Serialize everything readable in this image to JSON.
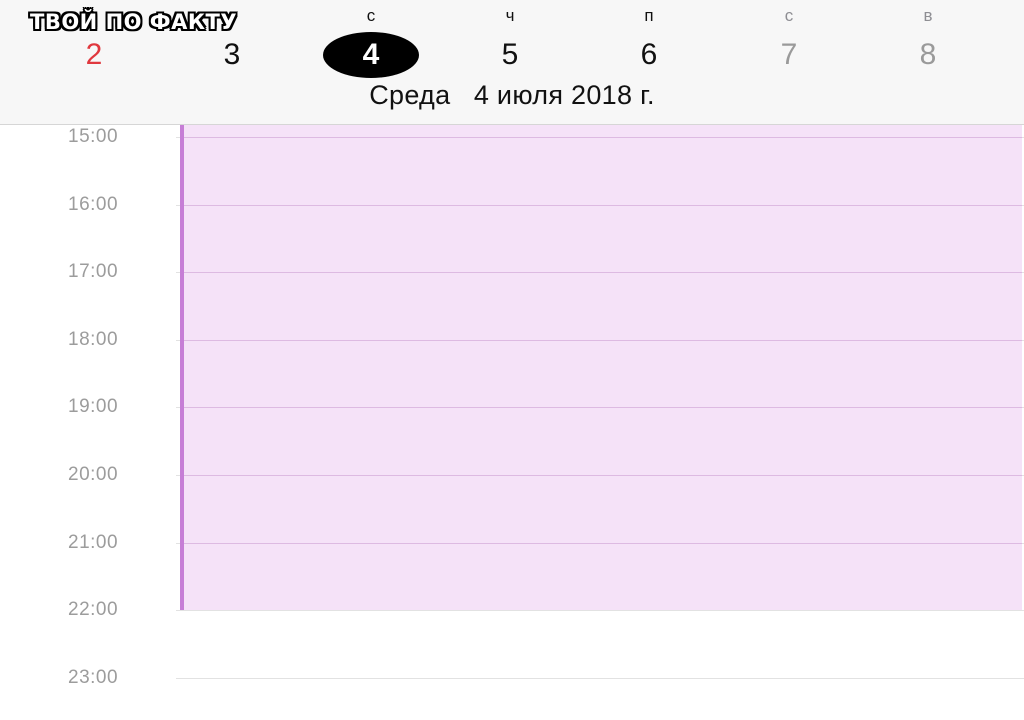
{
  "watermark": "ТВОЙ ПО ФАКТУ",
  "week": {
    "days": [
      {
        "weekday": "",
        "number": "2",
        "style": "sunday"
      },
      {
        "weekday": "",
        "number": "3",
        "style": "normal"
      },
      {
        "weekday": "с",
        "number": "4",
        "style": "selected"
      },
      {
        "weekday": "ч",
        "number": "5",
        "style": "normal"
      },
      {
        "weekday": "п",
        "number": "6",
        "style": "normal"
      },
      {
        "weekday": "с",
        "number": "7",
        "style": "weekend"
      },
      {
        "weekday": "в",
        "number": "8",
        "style": "weekend"
      }
    ],
    "selected_date_label": "Среда   4 июля 2018 г."
  },
  "timeline": {
    "hours": [
      "15:00",
      "16:00",
      "17:00",
      "18:00",
      "19:00",
      "20:00",
      "21:00",
      "22:00",
      "23:00"
    ]
  },
  "event": {
    "start": "15:00",
    "end": "22:00",
    "color": "#c67ed6"
  }
}
